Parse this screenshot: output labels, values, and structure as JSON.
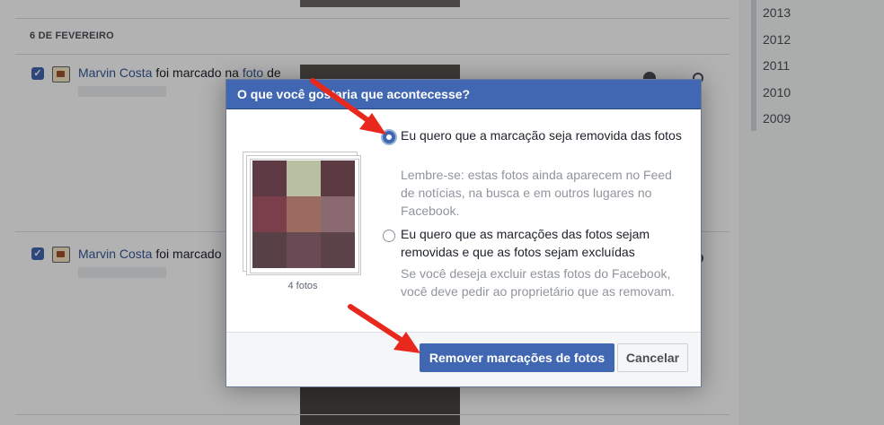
{
  "sidebar": {
    "years": [
      "2013",
      "2012",
      "2011",
      "2010",
      "2009"
    ]
  },
  "feed": {
    "date_label": "6 DE FEVEREIRO",
    "rows": [
      {
        "checked": "✓",
        "name": "Marvin Costa",
        "text_a": " foi marcado na ",
        "link": "foto",
        "text_b": " de"
      },
      {
        "checked": "✓",
        "name": "Marvin Costa",
        "text_a": " foi marcado"
      }
    ]
  },
  "dialog": {
    "title": "O que você gostaria que acontecesse?",
    "photo_count": "4 fotos",
    "options": [
      {
        "selected": true,
        "label": "Eu quero que a marcação seja removida das fotos",
        "help": "Lembre-se: estas fotos ainda aparecem no Feed de notícias, na busca e em outros lugares no Facebook."
      },
      {
        "selected": false,
        "label": "Eu quero que as marcações das fotos sejam removidas e que as fotos sejam excluídas",
        "help": "Se você deseja excluir estas fotos do Facebook, você deve pedir ao proprietário que as removam."
      }
    ],
    "primary_button": "Remover marcações de fotos",
    "cancel_button": "Cancelar"
  },
  "colors": {
    "header": "#4267b2",
    "link": "#365899",
    "arrow": "#e8281d",
    "pixelated_thumbnail": [
      "#5e3a45",
      "#b9c0a2",
      "#5b3a42",
      "#7a3f4b",
      "#9a6b5e",
      "#8a6a70",
      "#574147",
      "#6a4a55",
      "#5c4349"
    ]
  },
  "icons": [
    "checkbox-icon",
    "photo-tag-icon",
    "globe-icon",
    "pencil-icon",
    "radio-icon",
    "arrow-icon"
  ]
}
